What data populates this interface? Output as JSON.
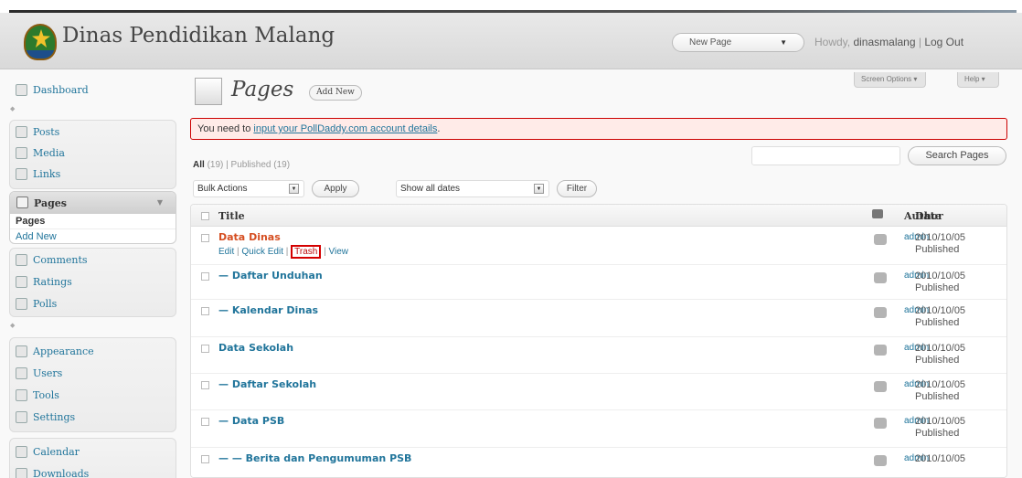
{
  "header": {
    "site_title": "Dinas Pendidikan Malang",
    "new_page_label": "New Page",
    "howdy_prefix": "Howdy,",
    "username": "dinasmalang",
    "separator": "|",
    "logout": "Log Out"
  },
  "screen_tabs": {
    "screen_options": "Screen Options ▾",
    "help": "Help ▾"
  },
  "sidebar": {
    "items": [
      {
        "label": "Dashboard",
        "icon": "dashboard-icon"
      },
      {
        "label": "Posts",
        "icon": "pin-icon"
      },
      {
        "label": "Media",
        "icon": "media-icon"
      },
      {
        "label": "Links",
        "icon": "link-icon"
      },
      {
        "label": "Pages",
        "icon": "page-icon"
      },
      {
        "label": "Comments",
        "icon": "comment-icon"
      },
      {
        "label": "Ratings",
        "icon": "ratings-icon"
      },
      {
        "label": "Polls",
        "icon": "polls-icon"
      },
      {
        "label": "Appearance",
        "icon": "appearance-icon"
      },
      {
        "label": "Users",
        "icon": "users-icon"
      },
      {
        "label": "Tools",
        "icon": "tools-icon"
      },
      {
        "label": "Settings",
        "icon": "settings-icon"
      },
      {
        "label": "Calendar",
        "icon": "calendar-icon"
      },
      {
        "label": "Downloads",
        "icon": "downloads-icon"
      }
    ],
    "pages_sub": [
      "Pages",
      "Add New"
    ]
  },
  "main": {
    "title": "Pages",
    "add_new": "Add New",
    "notice_prefix": "You need to ",
    "notice_link": "input your PollDaddy.com account details",
    "notice_suffix": ".",
    "filter_all": "All",
    "filter_all_count": "(19)",
    "filter_sep": "|",
    "filter_published": "Published",
    "filter_published_count": "(19)",
    "bulk_actions": "Bulk Actions",
    "apply": "Apply",
    "dates": "Show all dates",
    "filter": "Filter",
    "search_button": "Search Pages",
    "search_value": ""
  },
  "table": {
    "columns": {
      "title": "Title",
      "author": "Author",
      "date": "Date"
    },
    "row_actions": {
      "edit": "Edit",
      "sep": "|",
      "quick_edit": "Quick Edit",
      "trash": "Trash",
      "view": "View"
    },
    "rows": [
      {
        "title": "Data Dinas",
        "author": "admin",
        "date": "2010/10/05",
        "status": "Published"
      },
      {
        "title": "— Daftar Unduhan",
        "author": "admin",
        "date": "2010/10/05",
        "status": "Published"
      },
      {
        "title": "— Kalendar Dinas",
        "author": "admin",
        "date": "2010/10/05",
        "status": "Published"
      },
      {
        "title": "Data Sekolah",
        "author": "admin",
        "date": "2010/10/05",
        "status": "Published"
      },
      {
        "title": "— Daftar Sekolah",
        "author": "admin",
        "date": "2010/10/05",
        "status": "Published"
      },
      {
        "title": "— Data PSB",
        "author": "admin",
        "date": "2010/10/05",
        "status": "Published"
      },
      {
        "title": "— — Berita dan Pengumuman PSB",
        "author": "admin",
        "date": "2010/10/05",
        "status": ""
      }
    ]
  },
  "colors": {
    "link": "#21759b",
    "highlight": "#d54e21",
    "notice_bg": "#ffebe8",
    "trash_box": "#d40000"
  }
}
